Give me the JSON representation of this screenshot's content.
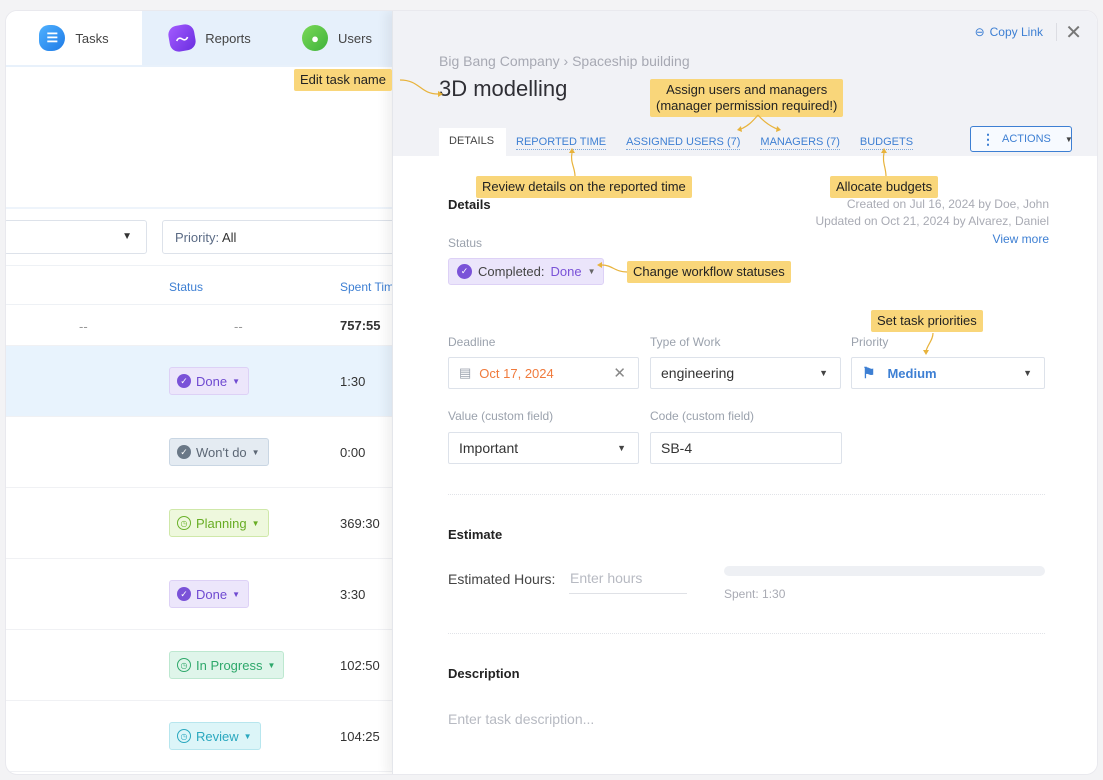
{
  "nav": {
    "tabs": [
      {
        "label": "Tasks",
        "icon": "tasks-icon"
      },
      {
        "label": "Reports",
        "icon": "reports-icon"
      },
      {
        "label": "Users",
        "icon": "users-icon"
      }
    ]
  },
  "filters": {
    "priority_label": "Priority:",
    "priority_value": "All"
  },
  "table": {
    "headers": {
      "status": "Status",
      "spent_time": "Spent Tim"
    },
    "summary": {
      "col1": "--",
      "col2": "--",
      "spent": "757:55"
    },
    "rows": [
      {
        "status": "Done",
        "spent": "1:30",
        "selected": true
      },
      {
        "status": "Won't do",
        "spent": "0:00"
      },
      {
        "status": "Planning",
        "spent": "369:30"
      },
      {
        "status": "Done",
        "spent": "3:30"
      },
      {
        "status": "In Progress",
        "spent": "102:50"
      },
      {
        "status": "Review",
        "spent": "104:25"
      }
    ]
  },
  "panel": {
    "copy_link": "Copy Link",
    "breadcrumb": "Big Bang Company › Spaceship building",
    "title": "3D modelling",
    "tabs": [
      "DETAILS",
      "REPORTED TIME",
      "ASSIGNED USERS (7)",
      "MANAGERS (7)",
      "BUDGETS"
    ],
    "actions_label": "ACTIONS",
    "details": {
      "section_title": "Details",
      "created": "Created on Jul 16, 2024 by Doe, John",
      "updated": "Updated on Oct 21, 2024 by Alvarez, Daniel",
      "view_more": "View more",
      "status_label": "Status",
      "status_group": "Completed:",
      "status_value": "Done",
      "deadline_label": "Deadline",
      "deadline_value": "Oct 17, 2024",
      "type_label": "Type of Work",
      "type_value": "engineering",
      "priority_label": "Priority",
      "priority_value": "Medium",
      "value_label": "Value (custom field)",
      "value_value": "Important",
      "code_label": "Code (custom field)",
      "code_value": "SB-4"
    },
    "estimate": {
      "section_title": "Estimate",
      "hours_label": "Estimated Hours:",
      "hours_placeholder": "Enter hours",
      "spent": "Spent: 1:30",
      "progress_fraction": 0
    },
    "description": {
      "section_title": "Description",
      "placeholder": "Enter task description..."
    }
  },
  "annotations": {
    "edit_name": "Edit task name",
    "assign": "Assign users and managers",
    "assign_sub": "(manager permission required!)",
    "reported": "Review details on the reported time",
    "budgets": "Allocate budgets",
    "workflow": "Change workflow statuses",
    "priorities": "Set task priorities"
  },
  "colors": {
    "accent": "#3d7fd3",
    "done": "#7a52d8",
    "deadline": "#f07a3c",
    "annotation": "#f9d67a"
  }
}
